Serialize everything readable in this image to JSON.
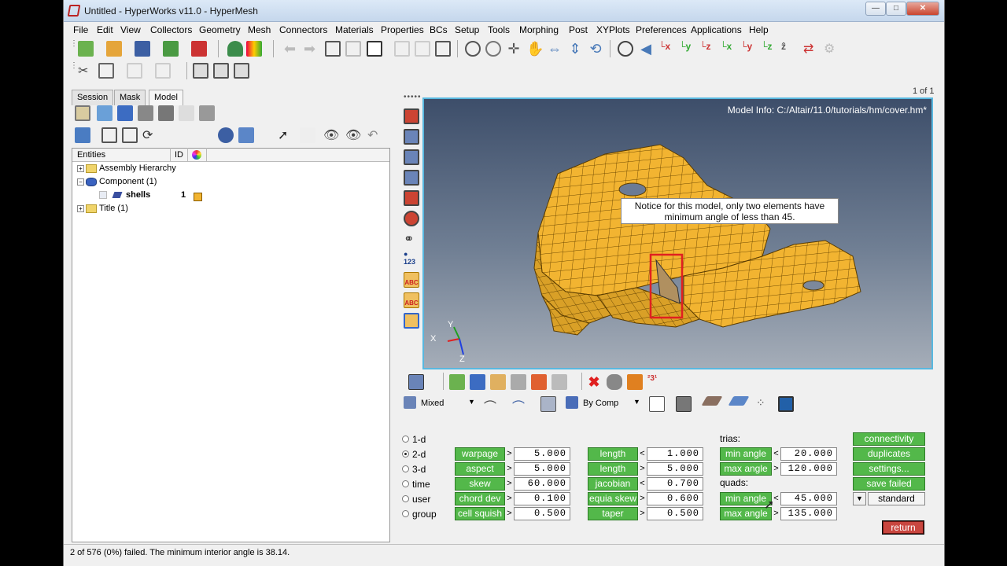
{
  "window": {
    "title": "Untitled - HyperWorks v11.0 - HyperMesh",
    "controls": [
      "—",
      "□",
      "✕"
    ]
  },
  "menu": [
    "File",
    "Edit",
    "View",
    "Collectors",
    "Geometry",
    "Mesh",
    "Connectors",
    "Materials",
    "Properties",
    "BCs",
    "Setup",
    "Tools",
    "Morphing",
    "Post",
    "XYPlots",
    "Preferences",
    "Applications",
    "Help"
  ],
  "left_panel": {
    "tabs": [
      "Session",
      "Mask",
      "Model"
    ],
    "active_tab": "Model",
    "columns": {
      "entities": "Entities",
      "id": "ID"
    },
    "tree": {
      "assembly": "Assembly Hierarchy",
      "component": "Component (1)",
      "shell_name": "shells",
      "shell_id": "1",
      "title": "Title (1)"
    }
  },
  "viewport": {
    "page": "1 of 1",
    "model_info": "Model Info: C:/Altair/11.0/tutorials/hm/cover.hm*",
    "callout": "Notice for this model, only two elements have minimum angle of less than 45.",
    "axis": {
      "x": "X",
      "y": "Y",
      "z": "Z"
    }
  },
  "bottom_toolbar": {
    "display_mode": "Mixed",
    "color_mode": "By Comp"
  },
  "check_panel": {
    "radios": [
      {
        "label": "1-d",
        "selected": false
      },
      {
        "label": "2-d",
        "selected": true
      },
      {
        "label": "3-d",
        "selected": false
      },
      {
        "label": "time",
        "selected": false
      },
      {
        "label": "user",
        "selected": false
      },
      {
        "label": "group",
        "selected": false
      }
    ],
    "col1": [
      {
        "label": "warpage",
        "op": ">",
        "value": "5.000"
      },
      {
        "label": "aspect",
        "op": ">",
        "value": "5.000"
      },
      {
        "label": "skew",
        "op": ">",
        "value": "60.000"
      },
      {
        "label": "chord dev",
        "op": ">",
        "value": "0.100"
      },
      {
        "label": "cell squish",
        "op": ">",
        "value": "0.500"
      }
    ],
    "col2": [
      {
        "label": "length",
        "op": "<",
        "value": "1.000"
      },
      {
        "label": "length",
        "op": ">",
        "value": "5.000"
      },
      {
        "label": "jacobian",
        "op": "<",
        "value": "0.700"
      },
      {
        "label": "equia skew",
        "op": ">",
        "value": "0.600"
      },
      {
        "label": "taper",
        "op": ">",
        "value": "0.500"
      }
    ],
    "trias_label": "trias:",
    "trias": [
      {
        "label": "min angle",
        "op": "<",
        "value": "20.000"
      },
      {
        "label": "max angle",
        "op": ">",
        "value": "120.000"
      }
    ],
    "quads_label": "quads:",
    "quads": [
      {
        "label": "min angle",
        "op": "<",
        "value": "45.000"
      },
      {
        "label": "max angle",
        "op": ">",
        "value": "135.000"
      }
    ],
    "actions": [
      "connectivity",
      "duplicates",
      "settings...",
      "save failed"
    ],
    "standard": "standard",
    "return_label": "return"
  },
  "status": "2 of 576 (0%) failed.  The minimum interior angle is 38.14.",
  "colors": {
    "green_button": "#53b84a",
    "return_button": "#c9463f",
    "mesh": "#f2b431",
    "highlight": "#e02020"
  }
}
